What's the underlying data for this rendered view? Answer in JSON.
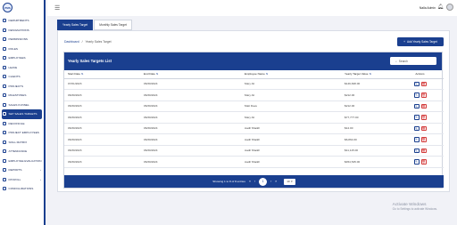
{
  "app": {
    "logo_text": "PMS",
    "menu_icon": "hamburger-icon"
  },
  "sidebar": {
    "items": [
      {
        "label": "DEPARTMENTS",
        "icon": "building-icon",
        "active": false
      },
      {
        "label": "DESIGNATIONS",
        "icon": "id-card-icon",
        "active": false
      },
      {
        "label": "PERMISSIONS",
        "icon": "lock-icon",
        "active": false
      },
      {
        "label": "ROLES",
        "icon": "roles-icon",
        "active": false
      },
      {
        "label": "EMPLOYEES",
        "icon": "users-icon",
        "active": false
      },
      {
        "label": "LEAVE",
        "icon": "calendar-icon",
        "active": false
      },
      {
        "label": "CLIENTS",
        "icon": "client-icon",
        "active": false
      },
      {
        "label": "PROJECTS",
        "icon": "folder-icon",
        "active": false
      },
      {
        "label": "MILESTONES",
        "icon": "flag-icon",
        "active": false
      },
      {
        "label": "SALES FUNNEL",
        "icon": "funnel-icon",
        "active": false
      },
      {
        "label": "SET SALES TARGETS",
        "icon": "target-icon",
        "active": true
      },
      {
        "label": "RECONCILE",
        "icon": "reconcile-icon",
        "active": false
      },
      {
        "label": "PROJECT EMPLOYEES",
        "icon": "team-icon",
        "active": false
      },
      {
        "label": "SKILL MATRIX",
        "icon": "matrix-icon",
        "active": false
      },
      {
        "label": "ATTENDANCE",
        "icon": "clock-icon",
        "active": false
      },
      {
        "label": "EMPLOYEE EVALUATION",
        "icon": "evaluation-icon",
        "active": false
      },
      {
        "label": "REPORTS",
        "icon": "chart-icon",
        "active": false,
        "has_children": true
      },
      {
        "label": "PAYROLL",
        "icon": "wallet-icon",
        "active": false,
        "has_children": true
      },
      {
        "label": "CONFIGURATIONS",
        "icon": "gear-icon",
        "active": false
      }
    ]
  },
  "topbar": {
    "user_name": "Nalla Admin"
  },
  "tabs": [
    {
      "label": "Yearly Sales Target",
      "active": true
    },
    {
      "label": "Monthly Sales Target",
      "active": false
    }
  ],
  "breadcrumb": {
    "home": "Dashboard",
    "separator": "/",
    "current": "Yearly Sales Target"
  },
  "add_button": {
    "label": "Add Yearly Sales Target"
  },
  "list": {
    "title": "Yearly Sales Targets List",
    "search_placeholder": "Search",
    "columns": [
      "Start Date",
      "End Date",
      "Employee Name",
      "Yearly Target Value",
      "Actions"
    ],
    "rows": [
      [
        "07/01/2023",
        "06/30/2024",
        "Mary Ali",
        "$149,848.00"
      ],
      [
        "06/30/2023",
        "06/30/2024",
        "Mary Ali",
        "$212.00"
      ],
      [
        "06/30/2023",
        "06/30/2024",
        "Matt Dave",
        "$212.00"
      ],
      [
        "06/30/2023",
        "06/30/2024",
        "Mary Ali",
        "$77,777.00"
      ],
      [
        "06/30/2023",
        "06/30/2024",
        "Aadil Shaikh",
        "$12.00"
      ],
      [
        "06/30/2023",
        "06/30/2024",
        "Aadil Shaikh",
        "$6,864.00"
      ],
      [
        "06/30/2023",
        "06/30/2024",
        "Aadil Shaikh",
        "$11,115.00"
      ],
      [
        "06/30/2023",
        "06/30/2024",
        "Aadil Shaikh",
        "$454,545.00"
      ]
    ],
    "pagination": {
      "summary": "Showing 1 to 8 of 8 entries",
      "first": "«",
      "prev": "‹",
      "current_page": "1",
      "next": "›",
      "last": "»",
      "per_page": "10"
    }
  },
  "watermark": {
    "title": "Activate Windows",
    "subtitle": "Go to Settings to activate Windows."
  },
  "colors": {
    "primary": "#1a3f8f",
    "danger": "#d33b3b",
    "background": "#f1f2f7"
  }
}
